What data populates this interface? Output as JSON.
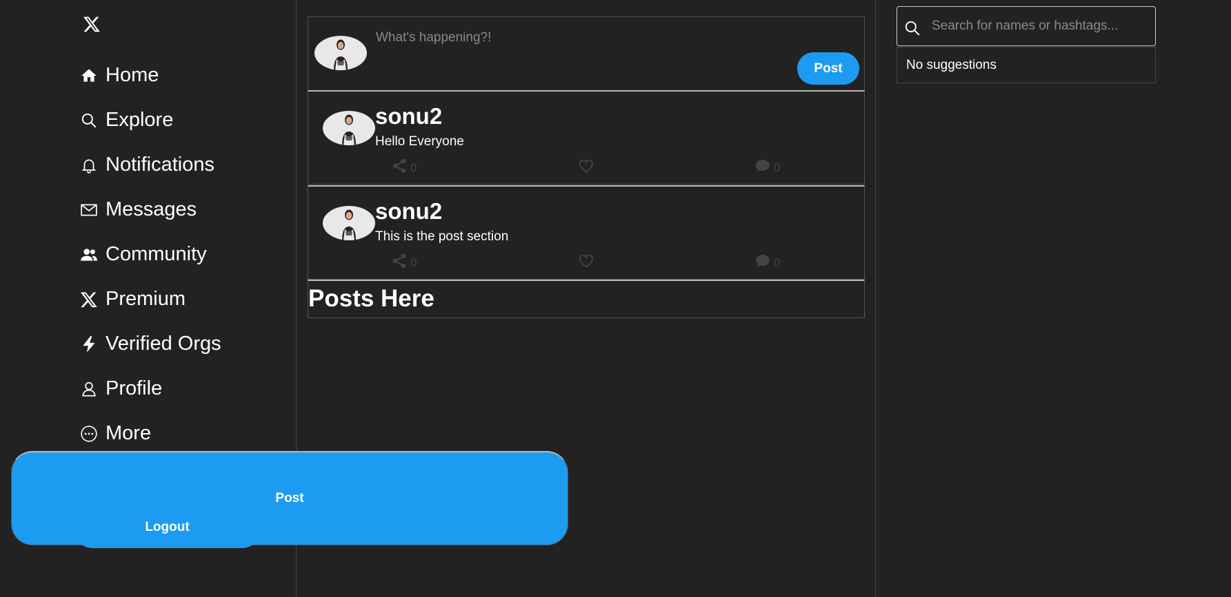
{
  "sidebar": {
    "logo_icon": "x-logo-icon",
    "items": [
      {
        "label": "Home",
        "icon": "home-icon"
      },
      {
        "label": "Explore",
        "icon": "search-icon"
      },
      {
        "label": "Notifications",
        "icon": "bell-icon"
      },
      {
        "label": "Messages",
        "icon": "mail-icon"
      },
      {
        "label": "Community",
        "icon": "users-icon"
      },
      {
        "label": "Premium",
        "icon": "x-logo-icon"
      },
      {
        "label": "Verified Orgs",
        "icon": "lightning-icon"
      },
      {
        "label": "Profile",
        "icon": "user-icon"
      },
      {
        "label": "More",
        "icon": "more-circle-icon"
      }
    ],
    "post_button": "Post",
    "logout_button": "Logout"
  },
  "composer": {
    "placeholder": "What's happening?!",
    "post_button": "Post"
  },
  "posts": [
    {
      "username": "sonu2",
      "body": "Hello Everyone",
      "shares": "0",
      "comments": "0"
    },
    {
      "username": "sonu2",
      "body": "This is the post section",
      "shares": "0",
      "comments": "0"
    }
  ],
  "feed_footer": "Posts Here",
  "search": {
    "placeholder": "Search for names or hashtags...",
    "suggestions_empty": "No suggestions"
  },
  "colors": {
    "background": "#222222",
    "accent": "#1d9bf0",
    "muted_icon": "#444444"
  }
}
